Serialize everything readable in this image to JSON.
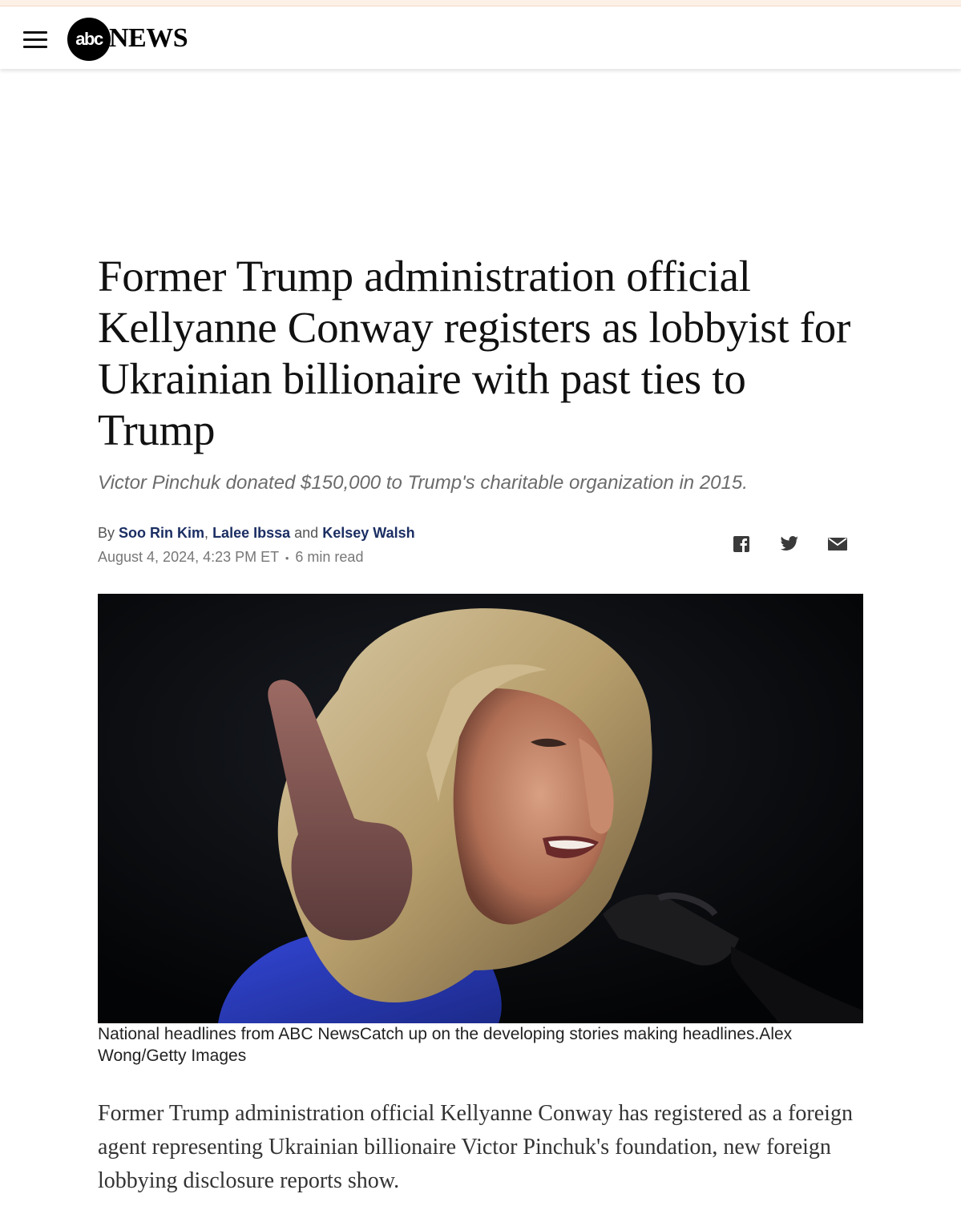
{
  "header": {
    "logo_abc": "abc",
    "logo_news": "NEWS",
    "menu_icon": "hamburger-menu-icon"
  },
  "article": {
    "headline": "Former Trump administration official Kellyanne Conway registers as lobbyist for Ukrainian billionaire with past ties to Trump",
    "subheadline": "Victor Pinchuk donated $150,000 to Trump's charitable organization in 2015.",
    "byline": {
      "prefix": "By",
      "authors": [
        "Soo Rin Kim",
        "Lalee Ibssa",
        "Kelsey Walsh"
      ],
      "separator_comma": ",",
      "separator_and": "and"
    },
    "date": "August 4, 2024, 4:23 PM ET",
    "read_time": "6 min read",
    "bullet": "•",
    "share": {
      "icons": [
        "facebook-icon",
        "twitter-icon",
        "email-icon"
      ]
    },
    "image_caption": "National headlines from ABC NewsCatch up on the developing stories making headlines.Alex Wong/Getty Images",
    "body_paragraph": "Former Trump administration official Kellyanne Conway has registered as a foreign agent representing Ukrainian billionaire Victor Pinchuk's foundation, new foreign lobbying disclosure reports show."
  },
  "colors": {
    "author_link": "#1b2e63",
    "subhead": "#6b6b6b",
    "image_background": "#040507",
    "dress_blue": "#2b3fc4"
  }
}
